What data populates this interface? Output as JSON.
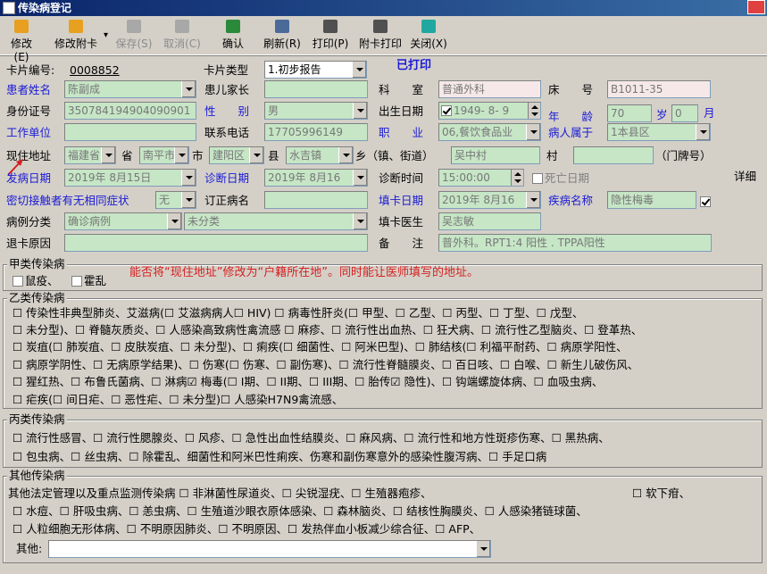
{
  "title": "传染病登记",
  "toolbar": [
    {
      "label": "修改(E)",
      "icon": "edit-icon",
      "disabled": false
    },
    {
      "label": "修改附卡",
      "icon": "edit-attach-icon",
      "disabled": false,
      "arrow": "▾"
    },
    {
      "label": "保存(S)",
      "icon": "save-icon",
      "disabled": true
    },
    {
      "label": "取消(C)",
      "icon": "cancel-icon",
      "disabled": true
    },
    {
      "label": "确认",
      "icon": "confirm-icon",
      "disabled": false
    },
    {
      "label": "刷新(R)",
      "icon": "refresh-icon",
      "disabled": false
    },
    {
      "label": "打印(P)",
      "icon": "print-icon",
      "disabled": false
    },
    {
      "label": "附卡打印",
      "icon": "print-attach-icon",
      "disabled": false
    },
    {
      "label": "关闭(X)",
      "icon": "close-icon",
      "disabled": false
    }
  ],
  "status_printed": "已打印",
  "form": {
    "card_no_label": "卡片编号:",
    "card_no": "0008852",
    "card_type_label": "卡片类型",
    "card_type": "1.初步报告",
    "patient_name_label": "患者姓名",
    "patient_name": "陈副成",
    "guardian_label": "患儿家长",
    "guardian": "",
    "dept_label": "科　　室",
    "dept": "普通外科",
    "bed_label": "床　　号",
    "bed": "B1011-35",
    "id_label": "身份证号",
    "id_no": "350784194904090901",
    "sex_label": "性　　别",
    "sex": "男",
    "birth_label": "出生日期",
    "birth": "1949- 8- 9",
    "age_label": "年　　龄",
    "age": "70",
    "age_unit": "岁",
    "age_month": "0",
    "month_unit": "月",
    "work_label": "工作单位",
    "work": "",
    "phone_label": "联系电话",
    "phone": "17705996149",
    "job_label": "职　　业",
    "job": "06,餐饮食品业",
    "belong_label": "病人属于",
    "belong": "1本县区",
    "addr_label": "现住地址",
    "addr_prov": "福建省",
    "prov_unit": "省",
    "addr_city": "南平市",
    "city_unit": "市",
    "addr_county": "建阳区",
    "county_unit": "县",
    "addr_town": "水吉镇",
    "town_unit": "乡（镇、街道）",
    "addr_village": "吴中村",
    "village_unit": "村",
    "addr_no": "",
    "no_unit": "（门牌号）",
    "onset_label": "发病日期",
    "onset": "2019年 8月15日",
    "diag_date_label": "诊断日期",
    "diag_date": "2019年 8月16",
    "diag_time_label": "诊断时间",
    "diag_time": "15:00:00",
    "death_label": "死亡日期",
    "detail_label": "详细",
    "contact_label": "密切接触者有无相同症状",
    "contact": "无",
    "revised_label": "订正病名",
    "revised": "",
    "fill_date_label": "填卡日期",
    "fill_date": "2019年 8月16",
    "disease_label": "疾病名称",
    "disease": "隐性梅毒",
    "case_class_label": "病例分类",
    "case_class": "确诊病例",
    "case_class2": "未分类",
    "doctor_label": "填卡医生",
    "doctor": "吴志敏",
    "withdraw_label": "退卡原因",
    "withdraw": "",
    "remark_label": "备　　注",
    "remark": "普外科。RPT1:4 阳性 . TPPA阳性"
  },
  "annotation": "能否将“现住地址”修改为“户籍所在地”。同时能让医师填写的地址。",
  "groups": {
    "a_title": "甲类传染病",
    "a_items": [
      "鼠疫、",
      "霍乱"
    ],
    "b_title": "乙类传染病",
    "b_lines": [
      "☐ 传染性非典型肺炎、艾滋病(☐ 艾滋病病人☐ HIV) ☐ 病毒性肝炎(☐ 甲型、☐ 乙型、☐ 丙型、☐ 丁型、☐ 戊型、",
      "☐ 未分型)、☐ 脊髓灰质炎、☐ 人感染高致病性禽流感 ☐ 麻疹、☐ 流行性出血热、☐ 狂犬病、☐ 流行性乙型脑炎、☐ 登革热、",
      "☐ 炭疽(☐ 肺炭疽、☐ 皮肤炭疽、☐ 未分型)、☐ 痢疾(☐ 细菌性、☐ 阿米巴型)、☐ 肺结核(☐ 利福平耐药、☐ 病原学阳性、",
      "☐ 病原学阴性、☐ 无病原学结果)、☐ 伤寒(☐ 伤寒、☐ 副伤寒)、☐ 流行性脊髓膜炎、☐ 百日咳、☐ 白喉、☐ 新生儿破伤风、",
      "☐ 猩红热、☐ 布鲁氏菌病、☐ 淋病☑ 梅毒(☐ I期、☐ II期、☐ III期、☐ 胎传☑ 隐性)、☐ 钩端螺旋体病、☐ 血吸虫病、",
      "☐ 疟疾(☐ 间日疟、☐ 恶性疟、☐ 未分型)☐ 人感染H7N9禽流感、"
    ],
    "c_title": "丙类传染病",
    "c_lines": [
      "☐ 流行性感冒、☐ 流行性腮腺炎、☐ 风疹、☐ 急性出血性结膜炎、☐ 麻风病、☐ 流行性和地方性斑疹伤寒、☐ 黑热病、",
      "☐ 包虫病、☐ 丝虫病、☐ 除霍乱、细菌性和阿米巴性痢疾、伤寒和副伤寒意外的感染性腹泻病、☐ 手足口病"
    ],
    "o_title": "其他传染病",
    "o_lines": [
      "其他法定管理以及重点监测传染病 ☐ 非淋菌性尿道炎、☐ 尖锐湿疣、☐ 生殖器疱疹、",
      "☐ 水痘、☐ 肝吸虫病、☐ 恙虫病、☐ 生殖道沙眼衣原体感染、☐ 森林脑炎、☐ 结核性胸膜炎、☐ 人感染猪链球菌、",
      "☐ 人粒细胞无形体病、☐ 不明原因肺炎、☐ 不明原因、☐ 发热伴血小板减少综合征、☐ AFP、"
    ],
    "o_soft": "☐ 软下疳、",
    "o_other_label": "其他:"
  }
}
